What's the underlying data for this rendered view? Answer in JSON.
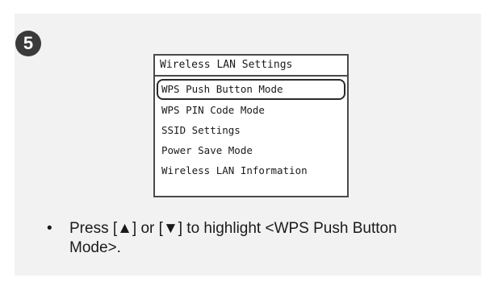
{
  "step": {
    "number": "5"
  },
  "screen": {
    "title": "Wireless LAN Settings",
    "items": [
      {
        "label": "WPS Push Button Mode",
        "selected": true
      },
      {
        "label": "WPS PIN Code Mode",
        "selected": false
      },
      {
        "label": "SSID Settings",
        "selected": false
      },
      {
        "label": "Power Save Mode",
        "selected": false
      },
      {
        "label": "Wireless LAN Information",
        "selected": false
      }
    ]
  },
  "instruction": {
    "bullet": "•",
    "text": "Press [▲] or [▼] to highlight <WPS Push Button Mode>."
  },
  "colors": {
    "panel_background": "#f2f2f2",
    "badge": "#3a3a3a",
    "screen_border": "#4a4a4a"
  }
}
